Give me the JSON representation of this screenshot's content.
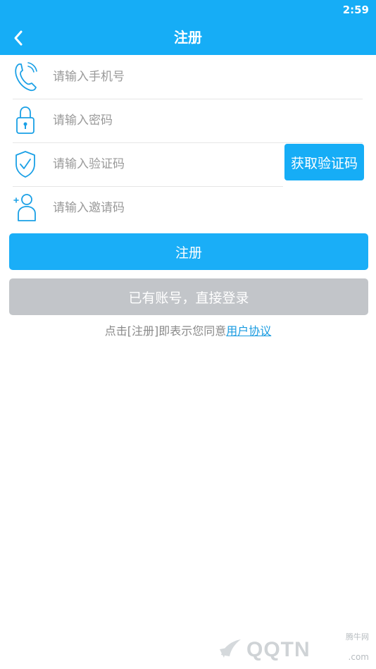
{
  "status_bar": {
    "time": "2:59"
  },
  "header": {
    "title": "注册"
  },
  "form": {
    "phone_placeholder": "请输入手机号",
    "password_placeholder": "请输入密码",
    "code_placeholder": "请输入验证码",
    "invite_placeholder": "请输入邀请码",
    "get_code_label": "获取验证码"
  },
  "actions": {
    "register_label": "注册",
    "login_label": "已有账号，直接登录"
  },
  "agreement": {
    "prefix": "点击[注册]即表示您同意",
    "link": "用户协议"
  },
  "watermark": {
    "brand": "QQTN",
    "cn": "腾牛网",
    "domain": ".com"
  },
  "colors": {
    "primary": "#16adf6",
    "disabled": "#c2c5c9",
    "link": "#1a9be0"
  }
}
